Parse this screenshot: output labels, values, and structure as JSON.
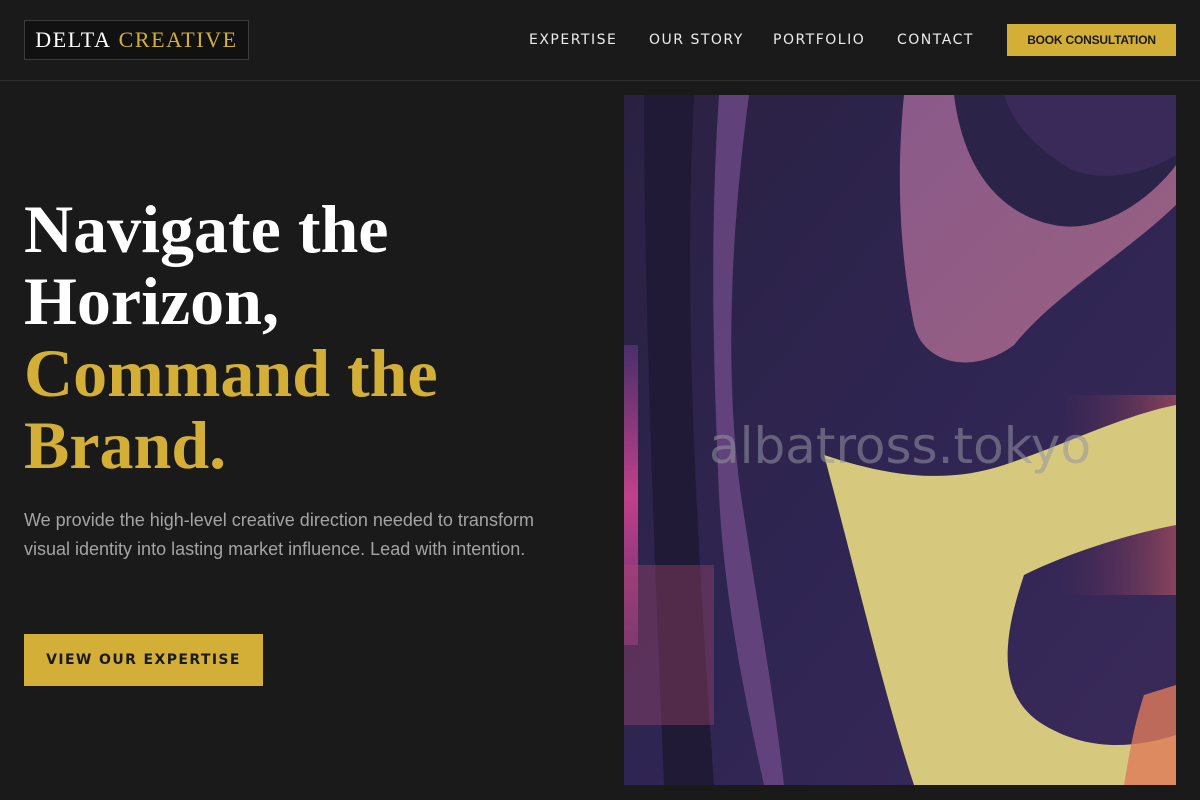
{
  "brand": {
    "name_part1": "DELTA",
    "name_part2": "CREATIVE"
  },
  "nav": {
    "items": [
      {
        "label": "EXPERTISE"
      },
      {
        "label": "OUR STORY"
      },
      {
        "label": "PORTFOLIO"
      },
      {
        "label": "CONTACT"
      }
    ],
    "cta_label": "BOOK CONSULTATION"
  },
  "hero": {
    "headline_lines": [
      "Navigate the",
      "Horizon,"
    ],
    "headline_accent_lines": [
      "Command the",
      "Brand."
    ],
    "description": "We provide the high-level creative direction needed to transform visual identity into lasting market influence. Lead with intention.",
    "cta_label": "VIEW OUR EXPERTISE",
    "image_watermark": "albatross.tokyo"
  },
  "colors": {
    "background": "#1a1a1a",
    "accent": "#d4af37",
    "text": "#ffffff",
    "muted_text": "#a4a4a4"
  }
}
